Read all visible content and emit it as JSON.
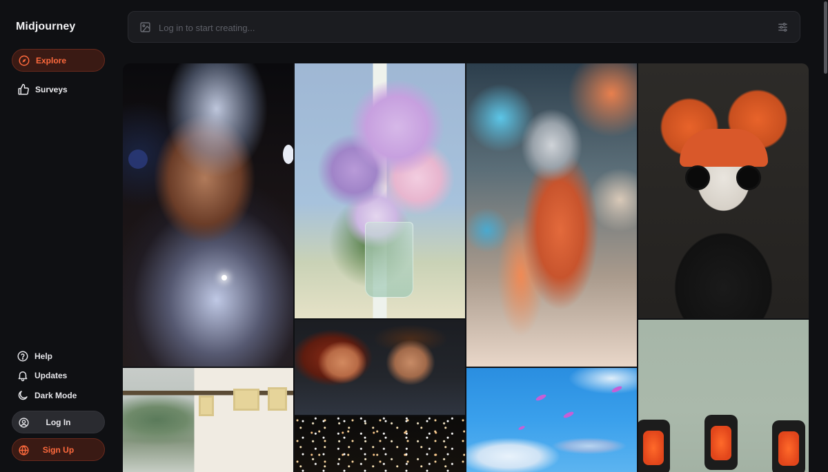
{
  "brand": {
    "name": "Midjourney"
  },
  "nav": {
    "explore": {
      "label": "Explore",
      "icon": "compass-icon"
    },
    "surveys": {
      "label": "Surveys",
      "icon": "thumbs-up-icon"
    }
  },
  "footer": {
    "help": {
      "label": "Help",
      "icon": "help-circle-icon"
    },
    "updates": {
      "label": "Updates",
      "icon": "bell-icon"
    },
    "dark_mode": {
      "label": "Dark Mode",
      "icon": "moon-icon"
    }
  },
  "auth": {
    "login_label": "Log In",
    "signup_label": "Sign Up"
  },
  "search": {
    "placeholder": "Log in to start creating...",
    "value": ""
  },
  "gallery": {
    "images": [
      {
        "subject": "crystal-headdress-portrait"
      },
      {
        "subject": "flowers-in-glass-vase"
      },
      {
        "subject": "low-poly-fox"
      },
      {
        "subject": "felt-doll-with-sunglasses"
      },
      {
        "subject": "painted-house-by-mountains"
      },
      {
        "subject": "retro-couple-film-still"
      },
      {
        "subject": "starfield"
      },
      {
        "subject": "sky-whales"
      },
      {
        "subject": "orange-eyed-robots"
      }
    ]
  },
  "colors": {
    "background": "#0f1013",
    "accent": "#ff6a3d",
    "accent_bg": "#3a1a14",
    "search_bg": "#1b1c20"
  }
}
